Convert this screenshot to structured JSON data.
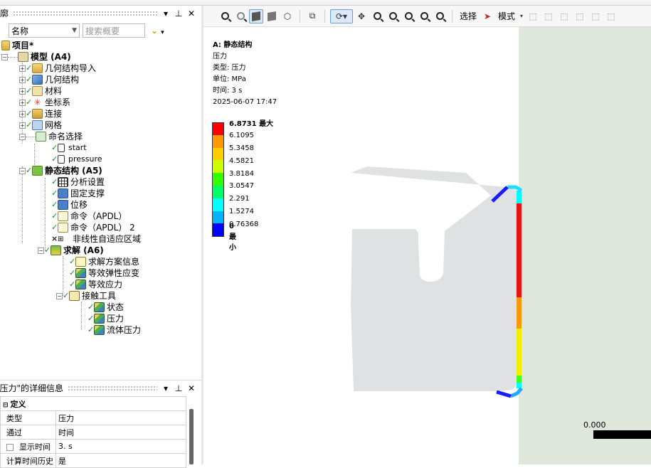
{
  "outline": {
    "title": "轮廓",
    "filter_field": "名称",
    "search_placeholder": "搜索概要",
    "tree": {
      "project": "项目*",
      "model": "模型 (A4)",
      "geometry_import": "几何结构导入",
      "geometry": "几何结构",
      "materials": "材料",
      "coordinate_systems": "坐标系",
      "connections": "连接",
      "mesh": "网格",
      "named_selections": "命名选择",
      "ns_start": "start",
      "ns_pressure": "pressure",
      "static_structural": "静态结构 (A5)",
      "analysis_settings": "分析设置",
      "fixed_support": "固定支撑",
      "displacement": "位移",
      "command1": "命令（APDL）",
      "command2": "命令（APDL） 2",
      "nonlinear_adaptive": "非线性自适应区域",
      "solution": "求解 (A6)",
      "solution_info": "求解方案信息",
      "equiv_elastic_strain": "等效弹性应变",
      "equiv_stress": "等效应力",
      "contact_tool": "接触工具",
      "status": "状态",
      "pressure": "压力",
      "fluid_pressure": "流体压力"
    }
  },
  "details": {
    "title": "\"压力\"的详细信息",
    "section": "定义",
    "rows": [
      {
        "label": "类型",
        "value": "压力"
      },
      {
        "label": "通过",
        "value": "时间"
      },
      {
        "label": "显示时间",
        "value": "3. s"
      },
      {
        "label": "计算时间历史",
        "value": "是"
      }
    ]
  },
  "toolbar": {
    "select_label": "选择",
    "mode_label": "模式"
  },
  "viewport": {
    "annotation": {
      "title": "A: 静态结构",
      "result": "压力",
      "type": "类型: 压力",
      "unit": "单位: MPa",
      "time": "时间: 3 s",
      "date": "2025-06-07 17:47"
    },
    "legend": {
      "max_value": "6.8731",
      "max_label": "最大",
      "values": [
        "6.1095",
        "5.3458",
        "4.5821",
        "3.8184",
        "3.0547",
        "2.291",
        "1.5274",
        "0.76368"
      ],
      "min_value": "0",
      "min_label": "最小",
      "colors": [
        "#ff0000",
        "#ff9900",
        "#ffcc00",
        "#ccff00",
        "#33ff00",
        "#00ff66",
        "#00ffff",
        "#00b3ff",
        "#0000ff"
      ]
    },
    "scale_text": "0.000",
    "background_color": "#dfe6dc",
    "body_color": "#dfe1e3"
  }
}
